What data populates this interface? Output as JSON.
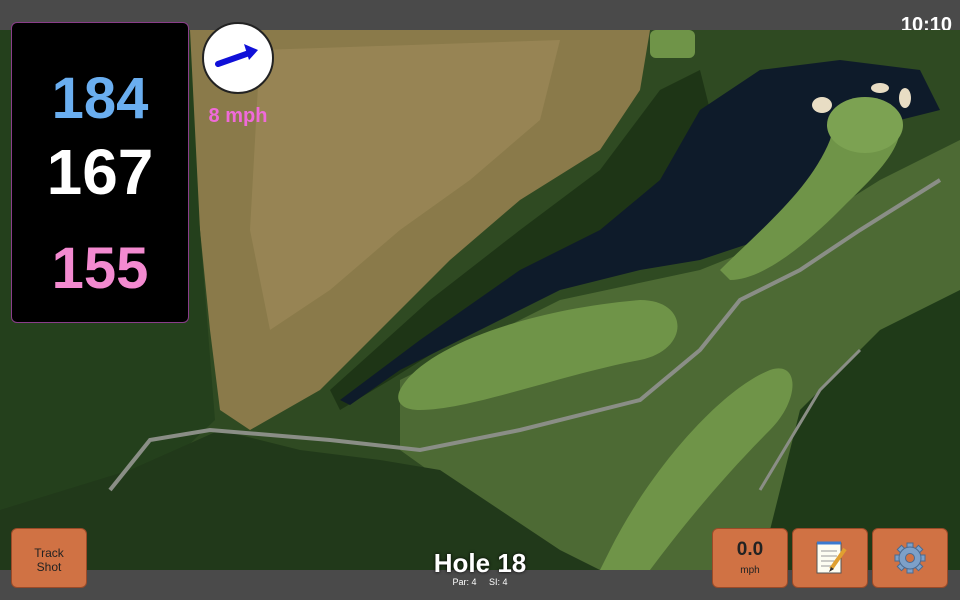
{
  "status_bar": {
    "time": "10:10"
  },
  "distances": {
    "back": "184",
    "middle": "167",
    "front": "155"
  },
  "wind": {
    "speed_label": "8 mph",
    "icon": "wind-arrow-icon"
  },
  "buttons": {
    "track_shot_line1": "Track",
    "track_shot_line2": "Shot",
    "speed_value": "0.0",
    "speed_unit": "mph",
    "notes_icon": "notepad-icon",
    "settings_icon": "gear-icon"
  },
  "hole": {
    "title": "Hole 18",
    "par": "Par: 4",
    "si": "SI: 4"
  },
  "colors": {
    "back_distance": "#6aaef0",
    "middle_distance": "#ffffff",
    "front_distance": "#f38ad0",
    "wind_label": "#f06ad9",
    "button": "#d07244"
  }
}
